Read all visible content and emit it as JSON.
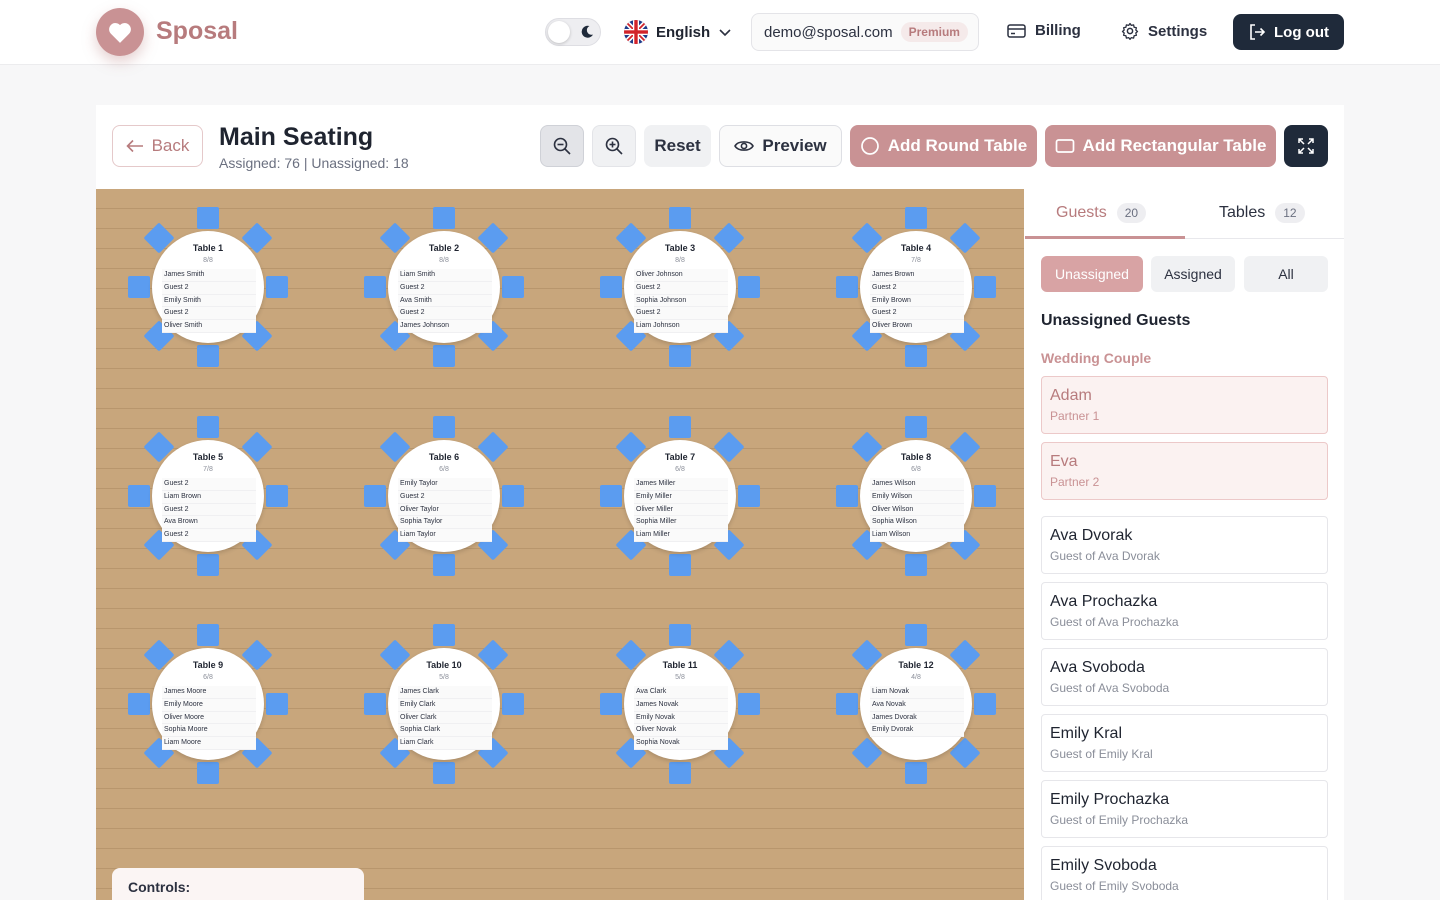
{
  "app": {
    "name": "Sposal"
  },
  "nav": {
    "language": "English",
    "email": "demo@sposal.com",
    "plan_badge": "Premium",
    "billing": "Billing",
    "settings": "Settings",
    "logout": "Log out"
  },
  "editor": {
    "back": "Back",
    "title": "Main Seating",
    "stats": "Assigned: 76 | Unassigned: 18",
    "reset": "Reset",
    "preview": "Preview",
    "add_round": "Add Round Table",
    "add_rect": "Add Rectangular Table",
    "controls_label": "Controls:"
  },
  "tables": [
    {
      "name": "Table 1",
      "count": "8/8",
      "guests": [
        "James Smith",
        "Guest 2",
        "Emily Smith",
        "Guest 2",
        "Oliver Smith"
      ]
    },
    {
      "name": "Table 2",
      "count": "8/8",
      "guests": [
        "Liam Smith",
        "Guest 2",
        "Ava Smith",
        "Guest 2",
        "James Johnson"
      ]
    },
    {
      "name": "Table 3",
      "count": "8/8",
      "guests": [
        "Oliver Johnson",
        "Guest 2",
        "Sophia Johnson",
        "Guest 2",
        "Liam Johnson"
      ]
    },
    {
      "name": "Table 4",
      "count": "7/8",
      "guests": [
        "James Brown",
        "Guest 2",
        "Emily Brown",
        "Guest 2",
        "Oliver Brown"
      ]
    },
    {
      "name": "Table 5",
      "count": "7/8",
      "guests": [
        "Guest 2",
        "Liam Brown",
        "Guest 2",
        "Ava Brown",
        "Guest 2"
      ]
    },
    {
      "name": "Table 6",
      "count": "6/8",
      "guests": [
        "Emily Taylor",
        "Guest 2",
        "Oliver Taylor",
        "Sophia Taylor",
        "Liam Taylor"
      ]
    },
    {
      "name": "Table 7",
      "count": "6/8",
      "guests": [
        "James Miller",
        "Emily Miller",
        "Oliver Miller",
        "Sophia Miller",
        "Liam Miller"
      ]
    },
    {
      "name": "Table 8",
      "count": "6/8",
      "guests": [
        "James Wilson",
        "Emily Wilson",
        "Oliver Wilson",
        "Sophia Wilson",
        "Liam Wilson"
      ]
    },
    {
      "name": "Table 9",
      "count": "6/8",
      "guests": [
        "James Moore",
        "Emily Moore",
        "Oliver Moore",
        "Sophia Moore",
        "Liam Moore"
      ]
    },
    {
      "name": "Table 10",
      "count": "5/8",
      "guests": [
        "James Clark",
        "Emily Clark",
        "Oliver Clark",
        "Sophia Clark",
        "Liam Clark"
      ]
    },
    {
      "name": "Table 11",
      "count": "5/8",
      "guests": [
        "Ava Clark",
        "James Novak",
        "Emily Novak",
        "Oliver Novak",
        "Sophia Novak"
      ]
    },
    {
      "name": "Table 12",
      "count": "4/8",
      "guests": [
        "Liam Novak",
        "Ava Novak",
        "James Dvorak",
        "Emily Dvorak"
      ]
    }
  ],
  "sidebar": {
    "tabs": [
      {
        "label": "Guests",
        "count": "20"
      },
      {
        "label": "Tables",
        "count": "12"
      }
    ],
    "filters": [
      "Unassigned",
      "Assigned",
      "All"
    ],
    "heading": "Unassigned Guests",
    "group_label": "Wedding Couple",
    "couple": [
      {
        "name": "Adam",
        "sub": "Partner 1"
      },
      {
        "name": "Eva",
        "sub": "Partner 2"
      }
    ],
    "guests": [
      {
        "name": "Ava Dvorak",
        "sub": "Guest of Ava Dvorak"
      },
      {
        "name": "Ava Prochazka",
        "sub": "Guest of Ava Prochazka"
      },
      {
        "name": "Ava Svoboda",
        "sub": "Guest of Ava Svoboda"
      },
      {
        "name": "Emily Kral",
        "sub": "Guest of Emily Kral"
      },
      {
        "name": "Emily Prochazka",
        "sub": "Guest of Emily Prochazka"
      },
      {
        "name": "Emily Svoboda",
        "sub": "Guest of Emily Svoboda"
      }
    ]
  },
  "colors": {
    "brand": "#c99294",
    "seat": "#5b9cf0",
    "floor": "#c8a67c",
    "dark": "#1f2a3a"
  }
}
